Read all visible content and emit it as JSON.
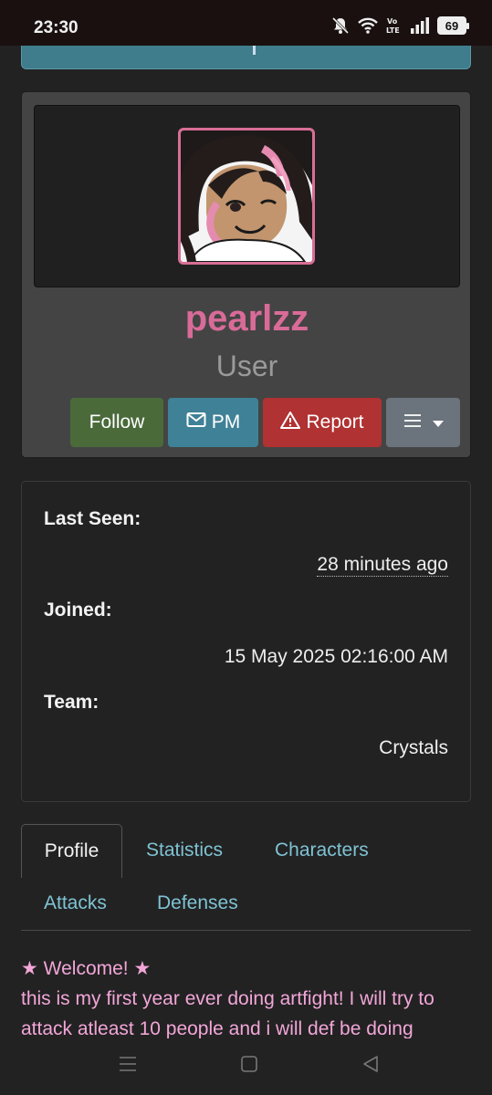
{
  "status_bar": {
    "time": "23:30",
    "battery": "69",
    "icons": [
      "bell-muted-icon",
      "wifi-icon",
      "volte-icon",
      "signal-icon",
      "battery-icon"
    ]
  },
  "profile": {
    "username": "pearlzz",
    "role": "User",
    "avatar_icon": "avatar-image",
    "buttons": {
      "follow": "Follow",
      "pm": "PM",
      "report": "Report"
    }
  },
  "info": {
    "last_seen_label": "Last Seen:",
    "last_seen_value": "28 minutes ago",
    "joined_label": "Joined:",
    "joined_value": "15 May 2025 02:16:00 AM",
    "team_label": "Team:",
    "team_value": "Crystals"
  },
  "tabs": {
    "profile": "Profile",
    "statistics": "Statistics",
    "characters": "Characters",
    "attacks": "Attacks",
    "defenses": "Defenses"
  },
  "bio": {
    "line1": "★ Welcome! ★",
    "line2": "this is my first year ever doing artfight! I will try to",
    "line3": "attack atleast 10 people and i will def be doing"
  },
  "colors": {
    "username": "#d96b98",
    "follow": "#4a6a3a",
    "pm": "#3f8196",
    "report": "#b03232",
    "menu": "#6b737c",
    "tab_link": "#7fc3d4",
    "bio_text": "#f2a6d8"
  }
}
